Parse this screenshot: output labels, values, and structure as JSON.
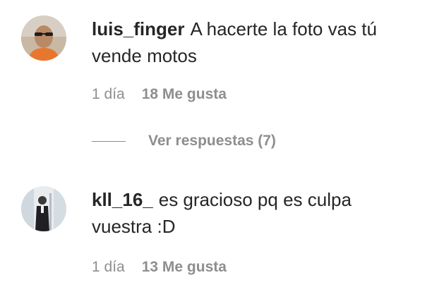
{
  "comments": [
    {
      "username": "luis_finger",
      "text": "A hacerte la foto vas tú vende motos",
      "time": "1 día",
      "likes": "18 Me gusta",
      "avatar_icon": "user-avatar-photo"
    },
    {
      "username": "kll_16_",
      "text": "es gracioso pq es culpa vuestra :D",
      "time": "1 día",
      "likes": "13 Me gusta",
      "avatar_icon": "user-avatar-photo"
    }
  ],
  "replies": {
    "label": "Ver respuestas (7)"
  },
  "colors": {
    "text": "#262626",
    "secondary": "#8e8e8e",
    "background": "#ffffff"
  }
}
